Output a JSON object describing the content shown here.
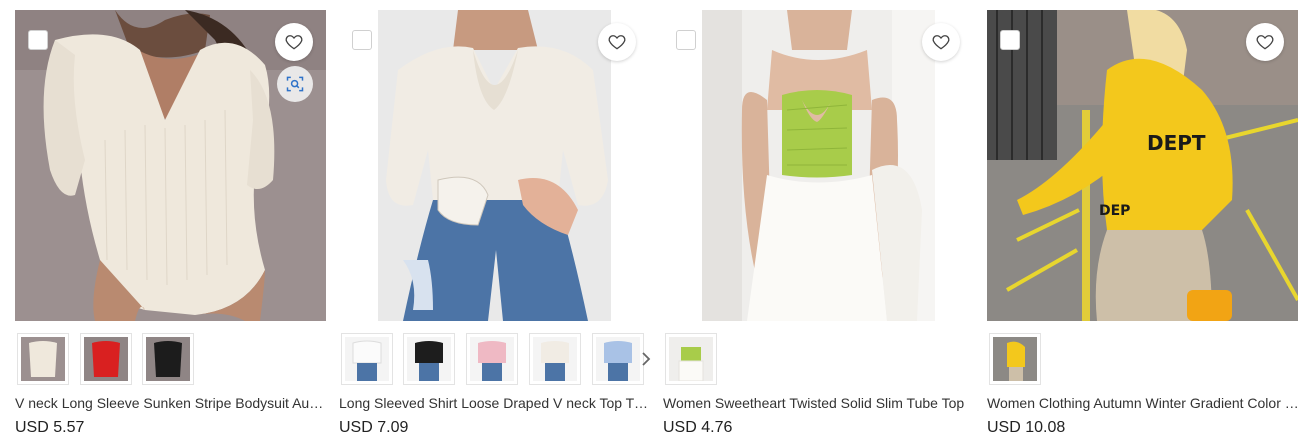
{
  "products": [
    {
      "title": "V neck Long Sleeve Sunken Stripe Bodysuit Autumn Winter Women Clothing",
      "price": "USD 5.57",
      "swatches": [
        "cream",
        "red",
        "black"
      ]
    },
    {
      "title": "Long Sleeved Shirt Loose Draped V neck Top T shirt Women",
      "price": "USD 7.09",
      "swatches": [
        "white",
        "black",
        "pink",
        "ivory",
        "light-blue"
      ]
    },
    {
      "title": "Women Sweetheart Twisted Solid Slim Tube Top",
      "price": "USD 4.76",
      "swatches": [
        "lime-green"
      ]
    },
    {
      "title": "Women Clothing Autumn Winter Gradient Color round Neck Sweatshirt",
      "price": "USD 10.08",
      "swatches": [
        "yellow"
      ]
    }
  ],
  "icons": {
    "favorite": "heart-outline-icon",
    "image_search": "scan-search-icon",
    "next": "chevron-right-icon"
  },
  "colors": {
    "text": "#333333",
    "price": "#222222",
    "border": "#e3e3e3",
    "image_search_accent": "#2f73c9"
  }
}
